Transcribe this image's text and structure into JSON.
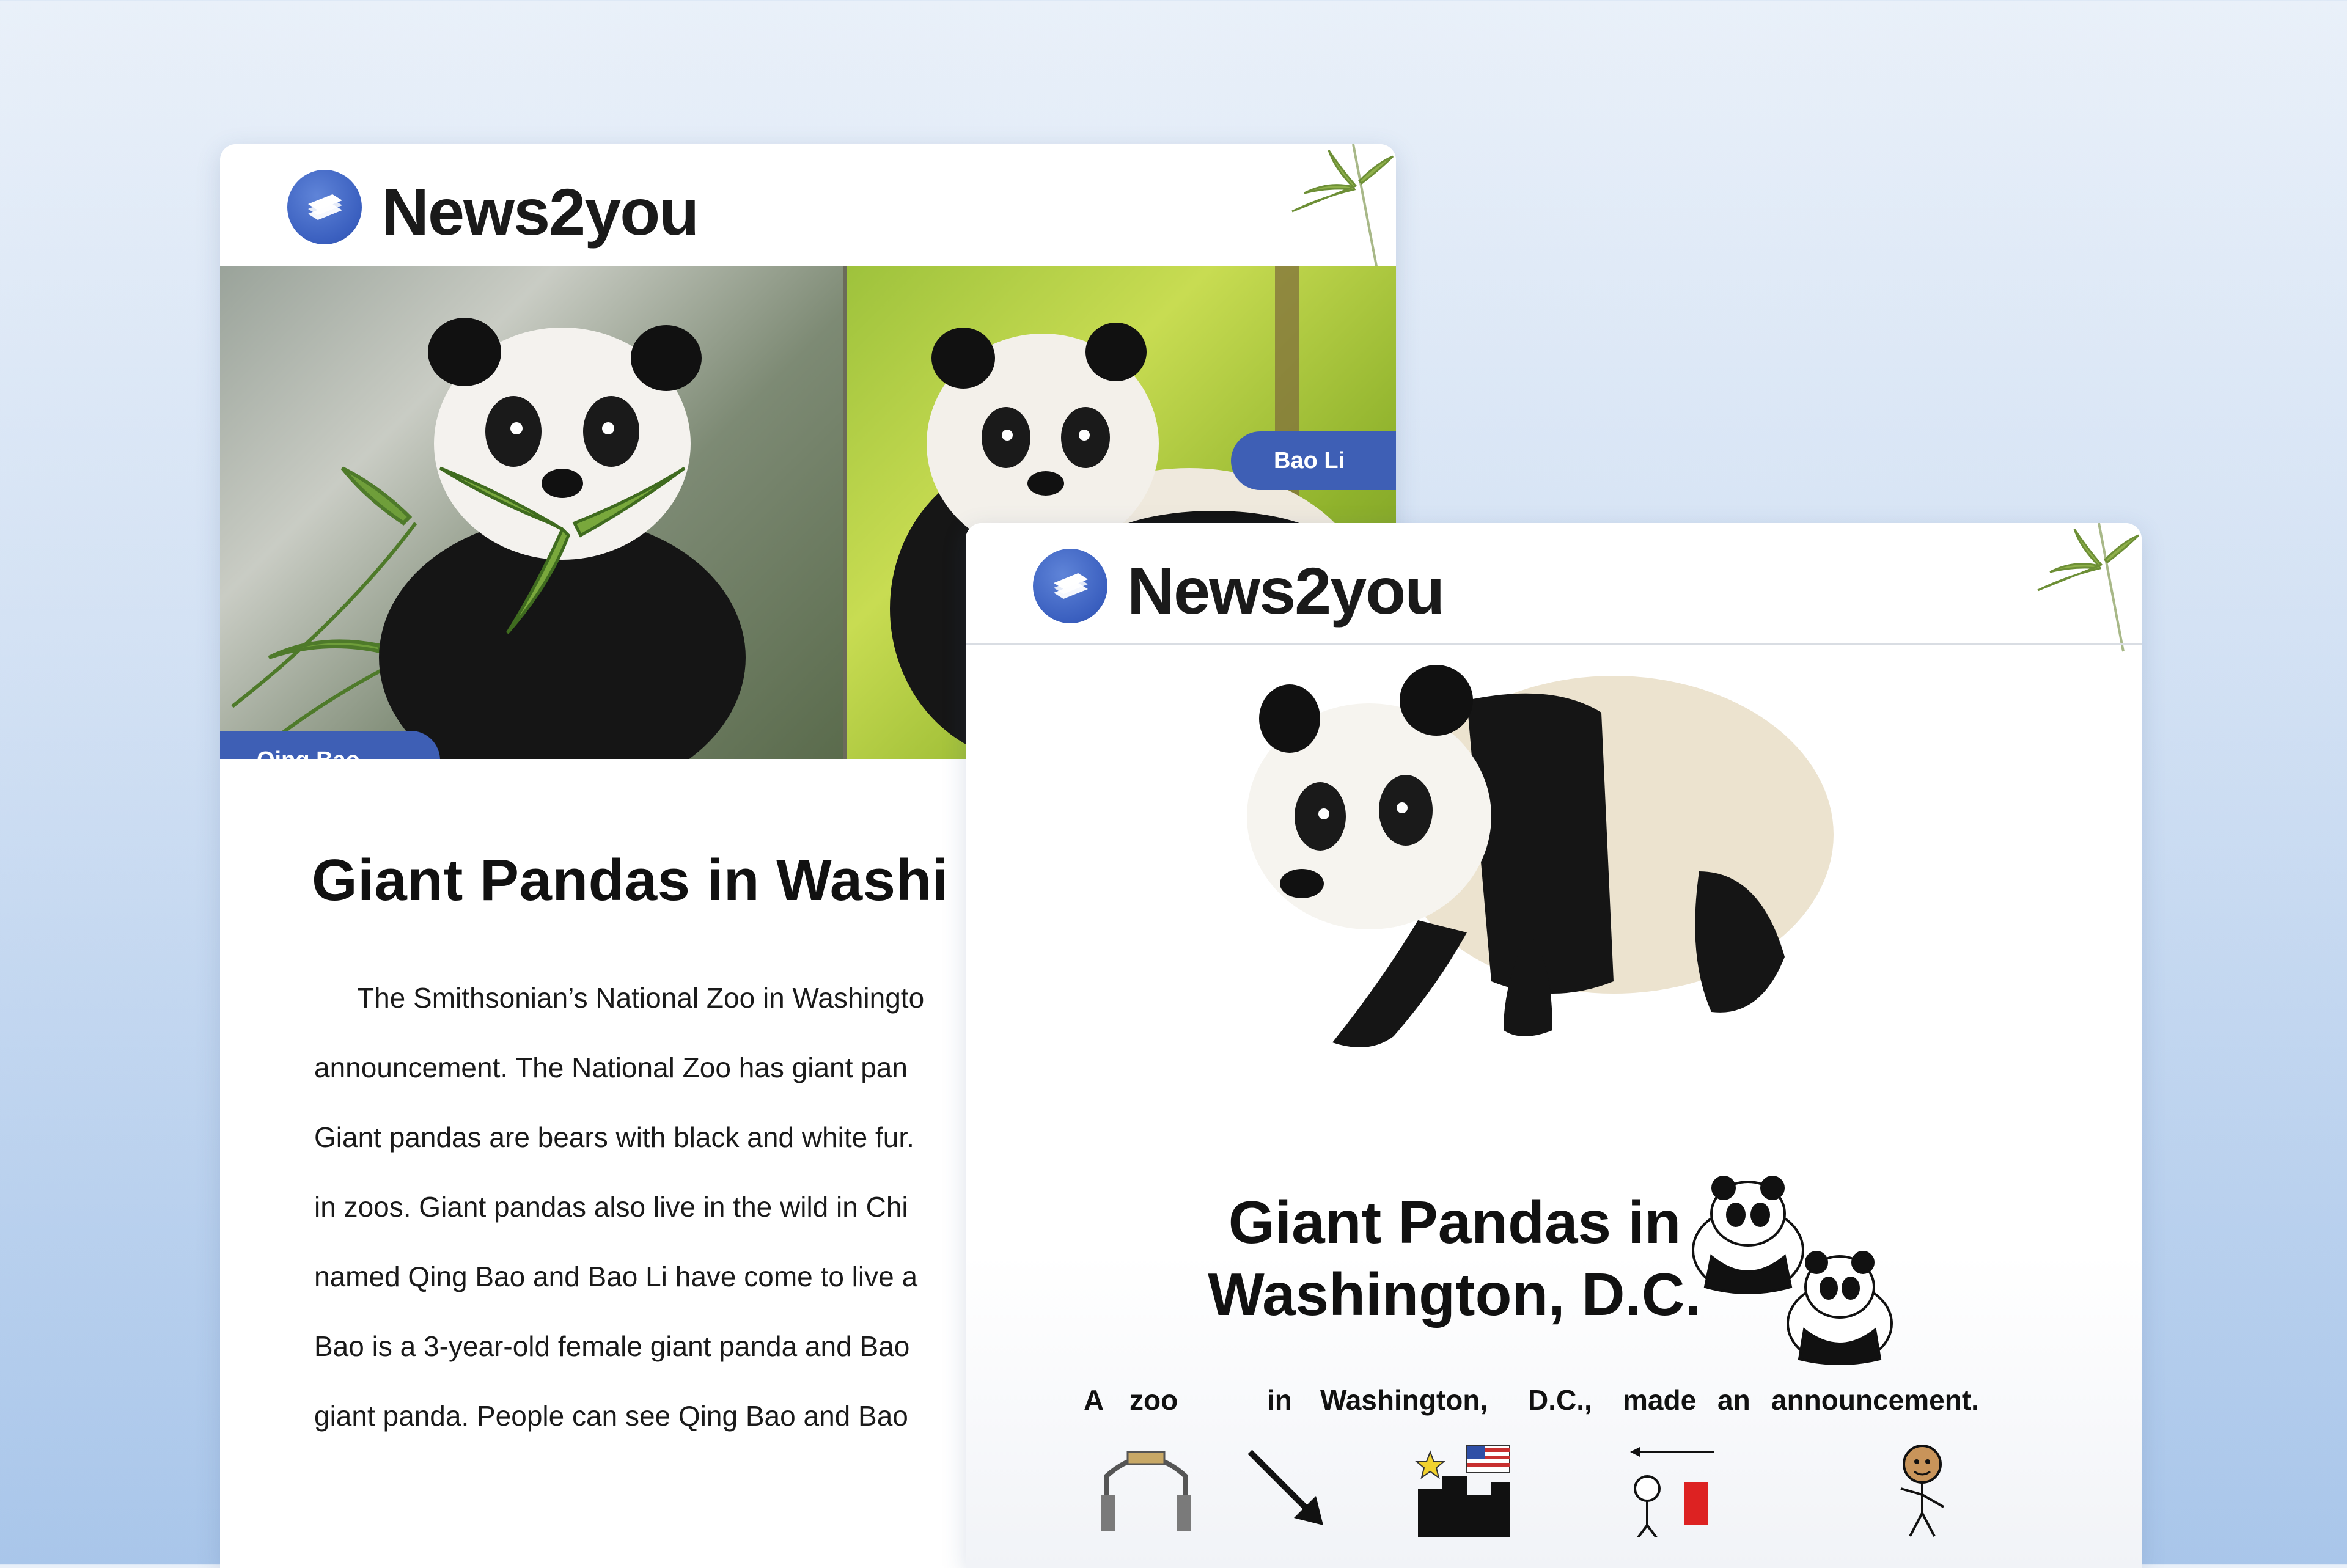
{
  "brand": {
    "name": "News2you"
  },
  "back_card": {
    "photo_tags": {
      "left": "Qing Bao",
      "right": "Bao Li"
    },
    "headline": "Giant Pandas in Washi",
    "article_lines": [
      "The Smithsonian’s National Zoo in Washingto",
      "announcement.  The National Zoo has giant pan",
      "Giant pandas are bears with black and white fur.",
      "in zoos.  Giant pandas also live in the wild in Chi",
      "named Qing Bao and Bao Li have come to live a",
      "Bao is a 3-year-old female giant panda and Bao",
      "giant panda.  People can see Qing Bao and Bao"
    ]
  },
  "front_card": {
    "title_line1": "Giant Pandas in",
    "title_line2": "Washington, D.C.",
    "sentence_words": [
      "A",
      "zoo",
      "in",
      "Washington,",
      "D.C.,",
      "made",
      "an",
      "announcement."
    ],
    "symbols": [
      "zoo-gate-icon",
      "arrow-in-icon",
      "city-flag-icon",
      "speaker-announce-icon",
      "person-talking-icon"
    ]
  },
  "colors": {
    "accent": "#3e5fb5",
    "logo": "#3a5fbf",
    "text": "#111111"
  }
}
